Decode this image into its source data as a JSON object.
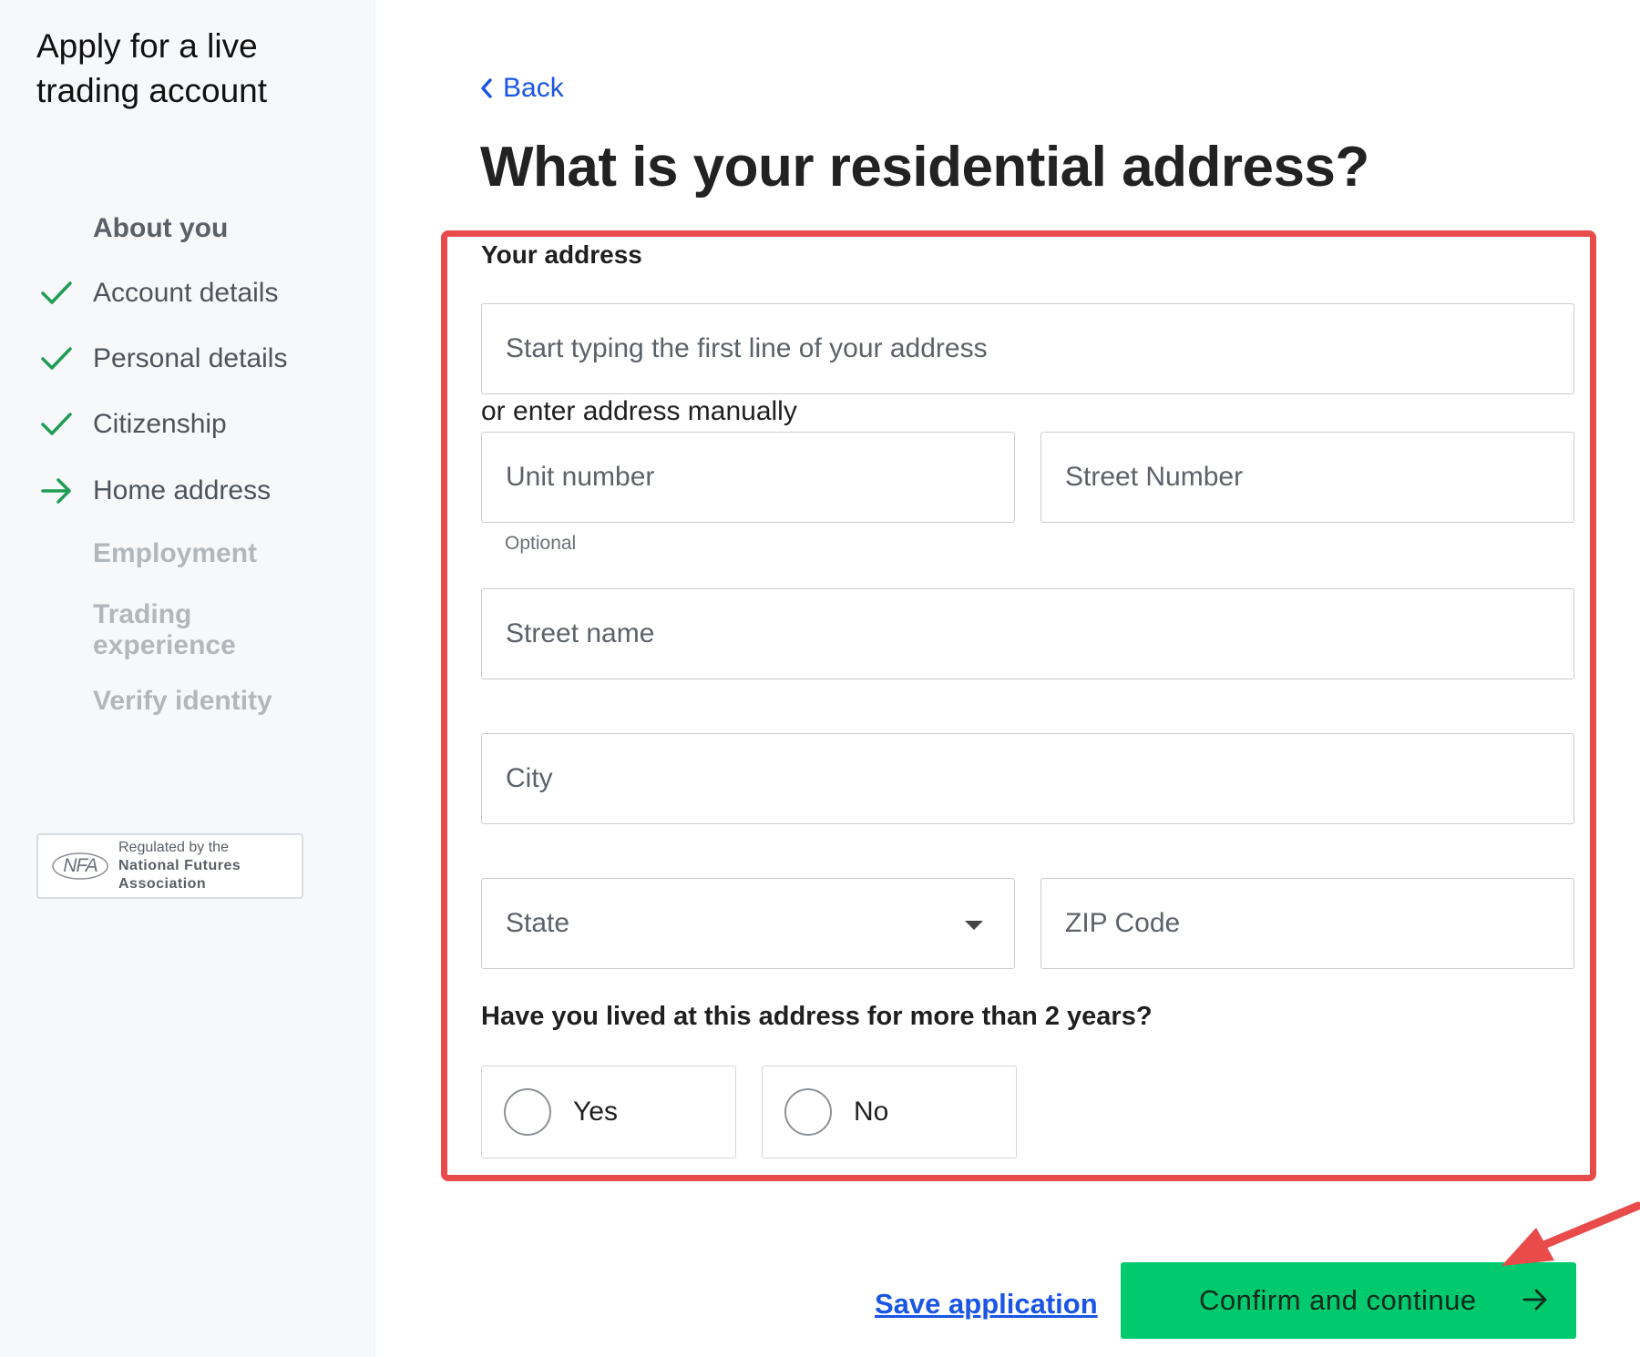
{
  "sidebar": {
    "title": "Apply for a live trading account",
    "steps_heading": "About you",
    "steps": [
      {
        "label": "Account details",
        "state": "done",
        "icon": "check-icon"
      },
      {
        "label": "Personal details",
        "state": "done",
        "icon": "check-icon"
      },
      {
        "label": "Citizenship",
        "state": "done",
        "icon": "check-icon"
      },
      {
        "label": "Home address",
        "state": "current",
        "icon": "arrow-right-icon"
      },
      {
        "label": "Employment",
        "state": "upcoming"
      },
      {
        "label": "Trading experience",
        "state": "upcoming"
      },
      {
        "label": "Verify identity",
        "state": "upcoming"
      }
    ],
    "badge": {
      "logo_text": "NFA",
      "line1": "Regulated by the",
      "line2": "National Futures",
      "line3": "Association"
    }
  },
  "main": {
    "back_label": "Back",
    "title": "What is your residential address?",
    "section_label": "Your address",
    "search_placeholder": "Start typing the first line of your address",
    "manual_text": "or enter address manually",
    "fields": {
      "unit_number": "Unit number",
      "unit_hint": "Optional",
      "street_number": "Street Number",
      "street_name": "Street name",
      "city": "City",
      "state": "State",
      "zip": "ZIP Code"
    },
    "question": "Have you lived at this address for more than 2 years?",
    "options": {
      "yes": "Yes",
      "no": "No"
    },
    "save_label": "Save application",
    "confirm_label": "Confirm and continue"
  },
  "colors": {
    "accent_green": "#00c96e",
    "check_green": "#1f9d55",
    "link_blue": "#1a55e3",
    "annotation_red": "#e94a4a"
  }
}
